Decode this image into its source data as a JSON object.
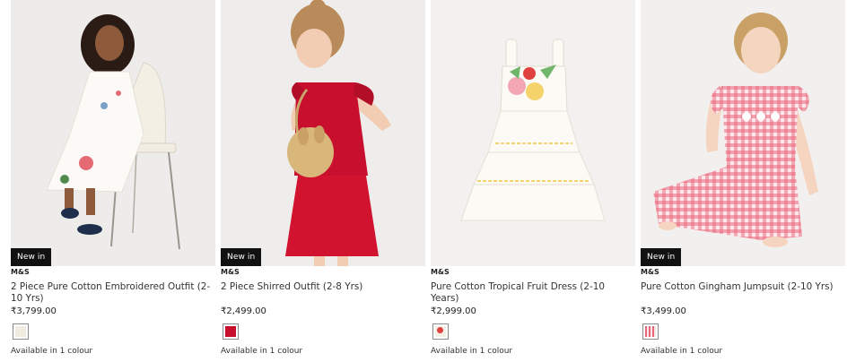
{
  "products": [
    {
      "badge": "New in",
      "brand": "M&S",
      "title": "2 Piece Pure Cotton Embroidered Outfit (2-10 Yrs)",
      "price": "₹3,799.00",
      "availability": "Available in 1 colour",
      "swatch_color": "#f1ece2"
    },
    {
      "badge": "New in",
      "brand": "M&S",
      "title": "2 Piece Shirred Outfit (2-8 Yrs)",
      "price": "₹2,499.00",
      "availability": "Available in 1 colour",
      "swatch_color": "#c8102e"
    },
    {
      "brand": "M&S",
      "title": "Pure Cotton Tropical Fruit Dress (2-10 Years)",
      "price": "₹2,999.00",
      "availability": "Available in 1 colour",
      "swatch_color": "#f4f0e6"
    },
    {
      "badge": "New in",
      "brand": "M&S",
      "title": "Pure Cotton Gingham Jumpsuit (2-10 Yrs)",
      "price": "₹3,499.00",
      "availability": "Available in 1 colour",
      "swatch_color": "#e8667a"
    }
  ]
}
